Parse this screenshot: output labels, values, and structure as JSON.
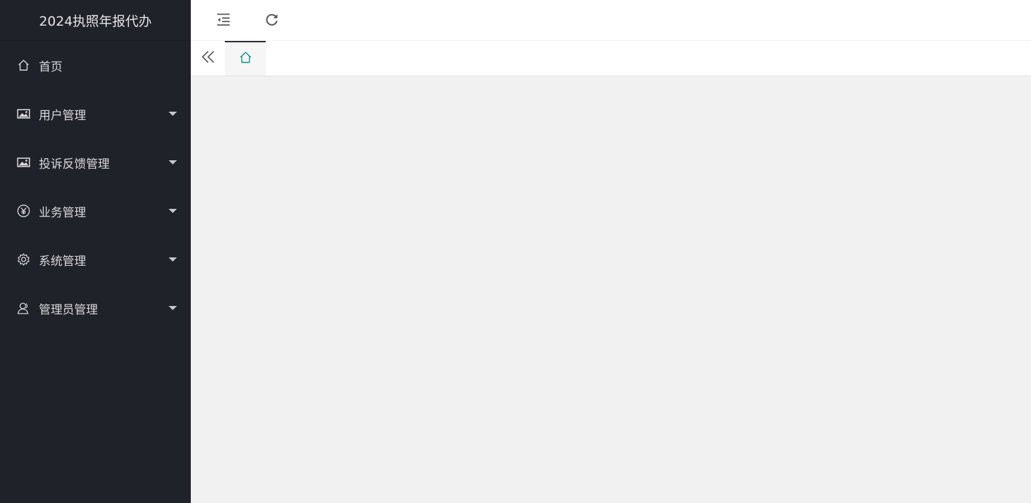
{
  "app": {
    "title": "2024执照年报代办"
  },
  "sidebar": {
    "items": [
      {
        "label": "首页",
        "icon": "home-icon",
        "has_submenu": false
      },
      {
        "label": "用户管理",
        "icon": "image-icon",
        "has_submenu": true
      },
      {
        "label": "投诉反馈管理",
        "icon": "image-icon",
        "has_submenu": true
      },
      {
        "label": "业务管理",
        "icon": "yen-circle-icon",
        "has_submenu": true
      },
      {
        "label": "系统管理",
        "icon": "gear-icon",
        "has_submenu": true
      },
      {
        "label": "管理员管理",
        "icon": "user-icon",
        "has_submenu": true
      }
    ]
  },
  "header": {
    "buttons": [
      {
        "name": "fold-menu",
        "icon": "indent-icon"
      },
      {
        "name": "refresh",
        "icon": "refresh-icon"
      }
    ]
  },
  "tabs": {
    "prev_icon": "double-chevron-left-icon",
    "items": [
      {
        "icon": "home-icon",
        "active": true
      }
    ]
  },
  "colors": {
    "sidebar_bg": "#20222a",
    "sidebar_text": "#d9d9d9",
    "accent": "#009688",
    "content_bg": "#f1f1f1"
  }
}
